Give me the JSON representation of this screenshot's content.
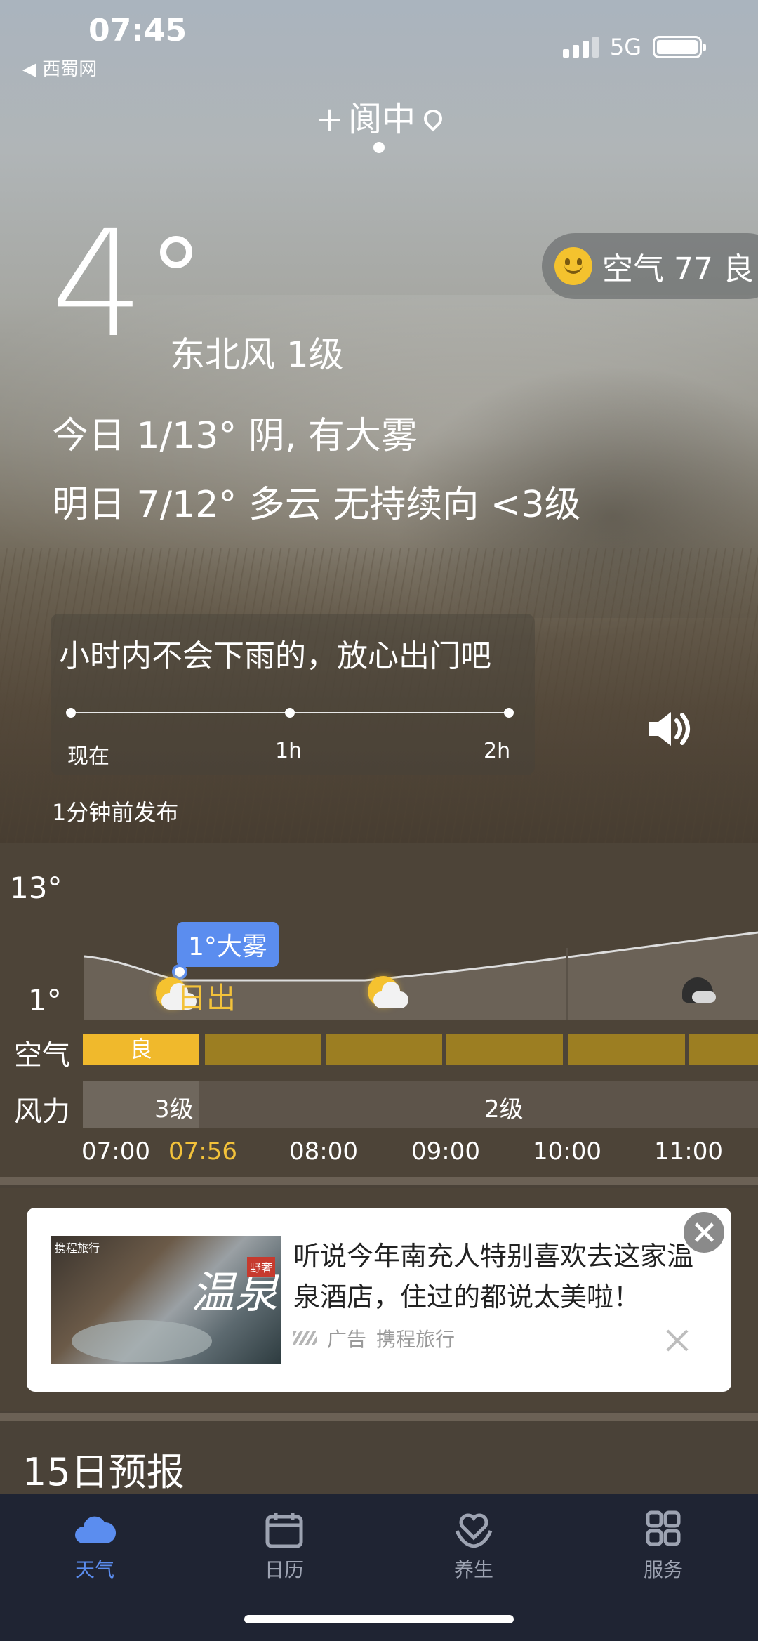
{
  "status": {
    "time": "07:45",
    "back_label": "◀ 西蜀网",
    "network": "5G"
  },
  "location": {
    "city": "阆中",
    "add_symbol": "+"
  },
  "current": {
    "temperature": "4",
    "wind": "东北风 1级"
  },
  "air_quality": {
    "label": "空气 77 良"
  },
  "forecast_lines": {
    "today": "今日 1/13° 阴, 有大雾",
    "tomorrow": "明日 7/12° 多云 无持续向 <3级"
  },
  "rain": {
    "message": "小时内不会下雨的，放心出门吧",
    "ticks": [
      "现在",
      "1h",
      "2h"
    ],
    "published": "1分钟前发布"
  },
  "hourly": {
    "high": "13°",
    "low": "1°",
    "tooltip": "1°大雾",
    "sunrise_text": "日出",
    "air_row_label": "空气",
    "air_first": "良",
    "wind_row_label": "风力",
    "wind_levels": [
      "3级",
      "2级"
    ],
    "times": [
      "07:00",
      "07:56",
      "08:00",
      "09:00",
      "10:00",
      "11:00"
    ],
    "highlight_color": "#f3c23a",
    "icons": [
      "sun-cloud-icon",
      "sun-cloud-icon",
      "cloudy-night-icon"
    ]
  },
  "ad": {
    "title": "听说今年南充人特别喜欢去这家温泉酒店，住过的都说太美啦！",
    "tag": "广告",
    "source": "携程旅行",
    "image_brand": "携程旅行",
    "image_text": "温泉",
    "image_tag": "野奢"
  },
  "section_title": "15日预报",
  "tabs": [
    {
      "label": "天气",
      "icon": "cloud-icon",
      "active": true
    },
    {
      "label": "日历",
      "icon": "calendar-icon",
      "active": false
    },
    {
      "label": "养生",
      "icon": "heart-hand-icon",
      "active": false
    },
    {
      "label": "服务",
      "icon": "grid-icon",
      "active": false
    }
  ],
  "colors": {
    "accent": "#5b8def",
    "aqi_good": "#f0b92c",
    "aqi_bar": "#9c7e22",
    "tabbar": "#1f2433"
  }
}
